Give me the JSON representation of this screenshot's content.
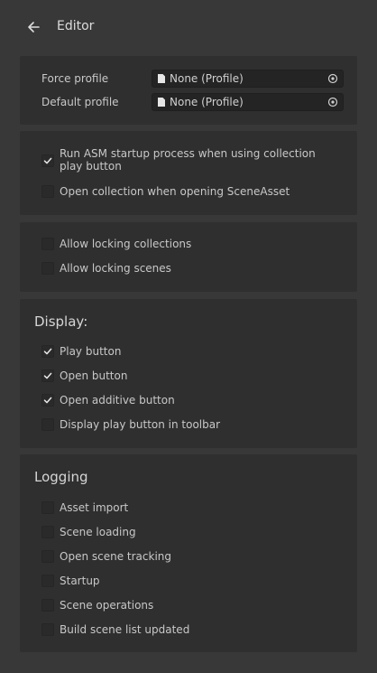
{
  "header": {
    "title": "Editor"
  },
  "profiles": {
    "force_label": "Force profile",
    "force_value": "None (Profile)",
    "default_label": "Default profile",
    "default_value": "None (Profile)"
  },
  "startup": {
    "run_asm": {
      "label": "Run ASM startup process when using collection play button",
      "checked": true
    },
    "open_collection": {
      "label": "Open collection when opening SceneAsset",
      "checked": false
    }
  },
  "locking": {
    "collections": {
      "label": "Allow locking collections",
      "checked": false
    },
    "scenes": {
      "label": "Allow locking scenes",
      "checked": false
    }
  },
  "display": {
    "title": "Display:",
    "items": [
      {
        "label": "Play button",
        "checked": true
      },
      {
        "label": "Open button",
        "checked": true
      },
      {
        "label": "Open additive button",
        "checked": true
      },
      {
        "label": "Display play button in toolbar",
        "checked": false
      }
    ]
  },
  "logging": {
    "title": "Logging",
    "items": [
      {
        "label": "Asset import",
        "checked": false
      },
      {
        "label": "Scene loading",
        "checked": false
      },
      {
        "label": "Open scene tracking",
        "checked": false
      },
      {
        "label": "Startup",
        "checked": false
      },
      {
        "label": "Scene operations",
        "checked": false
      },
      {
        "label": "Build scene list updated",
        "checked": false
      }
    ]
  },
  "icons": {
    "back": "arrow-left-icon",
    "file": "file-icon",
    "picker": "object-picker-icon",
    "check": "checkmark-icon"
  }
}
